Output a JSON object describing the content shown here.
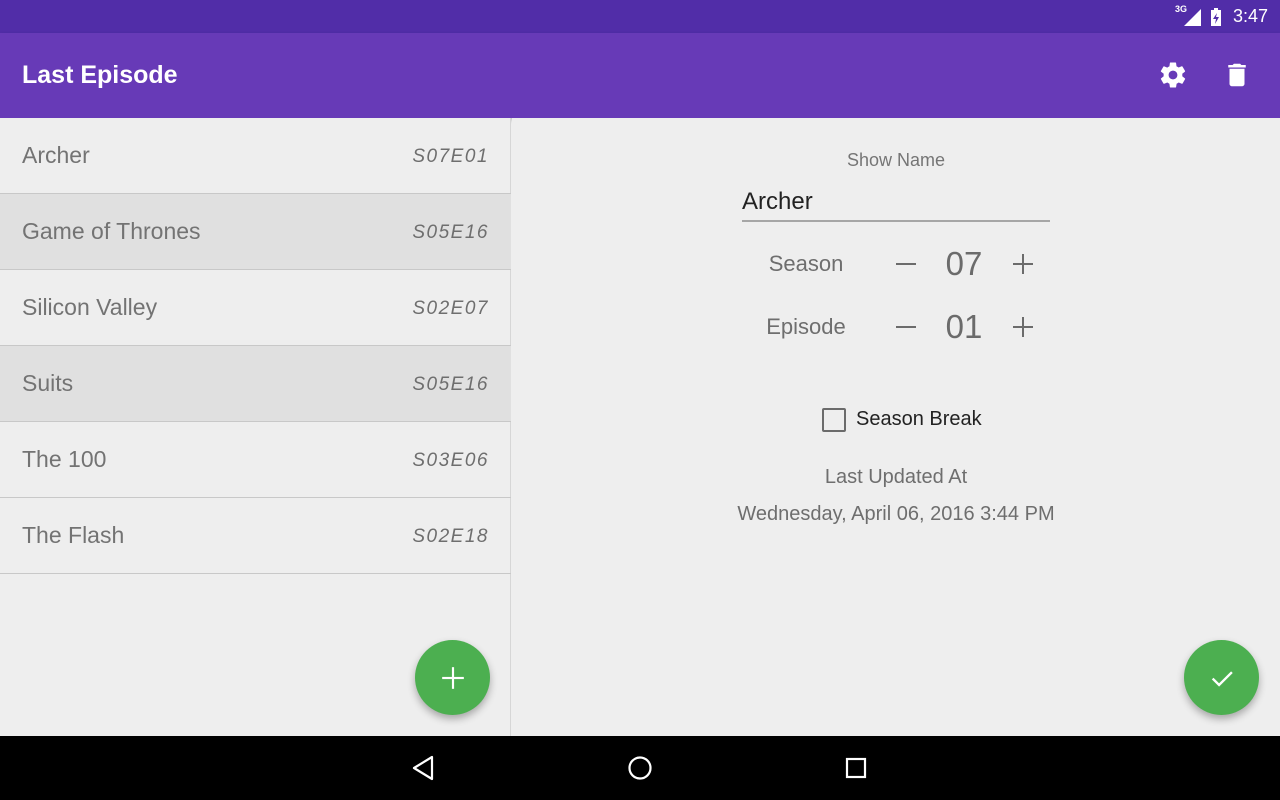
{
  "status_bar": {
    "network_label": "3G",
    "time": "3:47"
  },
  "app_bar": {
    "title": "Last Episode",
    "settings_icon": "gear-icon",
    "delete_icon": "trash-icon"
  },
  "shows": [
    {
      "title": "Archer",
      "episode": "S07E01"
    },
    {
      "title": "Game of Thrones",
      "episode": "S05E16"
    },
    {
      "title": "Silicon Valley",
      "episode": "S02E07"
    },
    {
      "title": "Suits",
      "episode": "S05E16"
    },
    {
      "title": "The 100",
      "episode": "S03E06"
    },
    {
      "title": "The Flash",
      "episode": "S02E18"
    }
  ],
  "detail": {
    "show_name_label": "Show Name",
    "show_name_value": "Archer",
    "season_label": "Season",
    "season_value": "07",
    "episode_label": "Episode",
    "episode_value": "01",
    "season_break_label": "Season Break",
    "season_break_checked": false,
    "last_updated_label": "Last Updated At",
    "last_updated_value": "Wednesday, April 06, 2016 3:44 PM"
  },
  "colors": {
    "status_bar": "#512da8",
    "app_bar": "#673ab7",
    "fab": "#4caf50"
  }
}
